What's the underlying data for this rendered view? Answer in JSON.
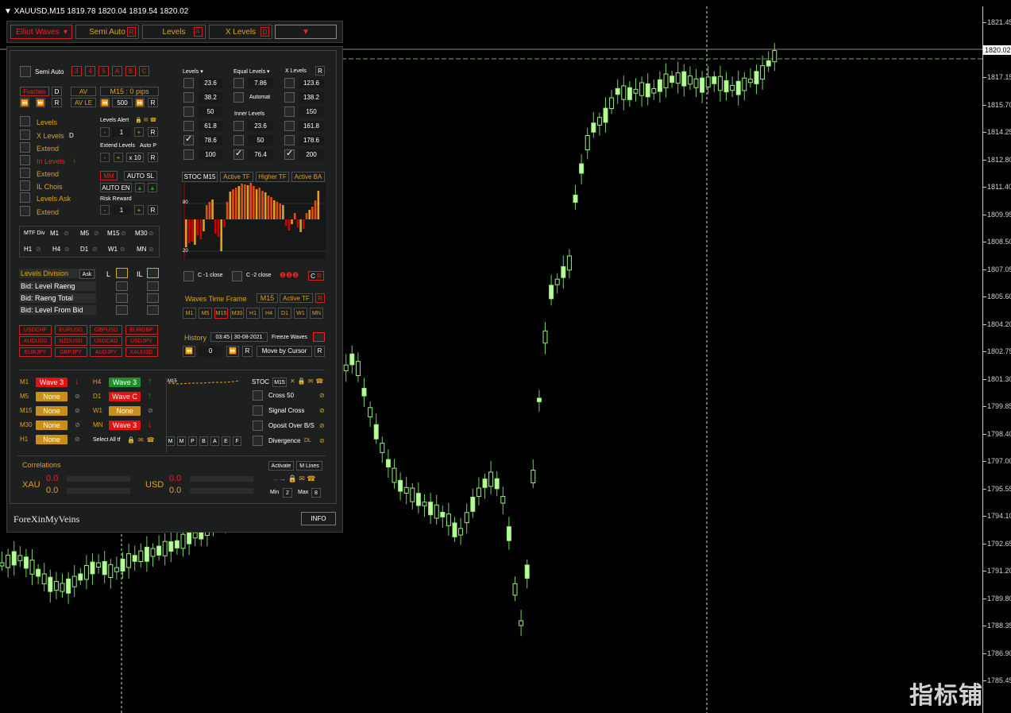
{
  "window": {
    "symbol_info": "XAUUSD,M15  1819.78 1820.04 1819.54 1820.02",
    "current_price": "1820.02",
    "watermark": "指标铺"
  },
  "price_axis": [
    "1821.45",
    "1818.60",
    "1817.15",
    "1815.70",
    "1814.25",
    "1812.80",
    "1811.40",
    "1809.95",
    "1808.50",
    "1807.05",
    "1805.60",
    "1804.20",
    "1802.75",
    "1801.30",
    "1799.85",
    "1798.40",
    "1797.00",
    "1795.55",
    "1794.10",
    "1792.65",
    "1791.20",
    "1789.80",
    "1788.35",
    "1786.90",
    "1785.45"
  ],
  "toolbar": {
    "elliot": "Elliot Waves",
    "semi_auto": "Semi Auto",
    "semi_auto_badge": "R",
    "levels": "Levels",
    "levels_badge": "IL",
    "x_levels": "X Levels",
    "x_levels_badge": "D"
  },
  "left": {
    "semi_auto": "Semi Auto",
    "wave_buttons": [
      "3",
      "4",
      "5",
      "A",
      "B",
      "C"
    ],
    "fractals": "Fractals",
    "fractals_d": "D",
    "av": "AV",
    "tf_pips": "M15 : 0  pips",
    "av_le": "AV LE",
    "nav_val": "500",
    "r": "R",
    "checks": [
      "Levels",
      "X Levels",
      "Extend",
      "In Levels",
      "Extend",
      "IL Chois",
      "Levels Ask",
      "Extend"
    ],
    "x_levels_d": "D",
    "levels_alert": "Levels Alert",
    "alert_val": "1",
    "extend_levels": "Extend Levels",
    "auto_p": "Auto P",
    "x10": "x 10",
    "mm": "MM",
    "auto_sl": "AUTO SL",
    "auto_en": "AUTO EN",
    "risk_reward": "Risk Reward",
    "rr_val": "1",
    "minus": "-",
    "plus": "+",
    "mtf_div": "MTF Div",
    "mtf_row1": [
      "M1",
      "M5",
      "M15",
      "M30"
    ],
    "mtf_row2": [
      "H1",
      "H4",
      "D1",
      "W1",
      "MN"
    ],
    "levels_division": "Levels Division",
    "ask": "Ask",
    "l": "L",
    "il": "IL",
    "bid_rows": [
      "Bid: Level Raeng",
      "Bid: Raeng Total",
      "Bid: Level From Bid"
    ],
    "pairs": [
      "USDCHF",
      "EURUSD",
      "GBPUSD",
      "EURGBP",
      "AUDUSD",
      "NZDUSD",
      "USDCAD",
      "USDJPY",
      "EURJPY",
      "GBPJPY",
      "AUDJPY",
      "XAUUSD"
    ]
  },
  "right": {
    "levels": "Levels",
    "equal_levels": "Equal Levels",
    "x_levels": "X Levels",
    "x_r": "R",
    "levels_vals": [
      "23.6",
      "38.2",
      "50",
      "61.8",
      "78.6",
      "100"
    ],
    "levels_checked": [
      false,
      false,
      false,
      false,
      true,
      false
    ],
    "equal_val": "7.86",
    "automat": "Automat",
    "inner_levels": "Inner Levels",
    "inner_vals": [
      "23.6",
      "50",
      "76.4"
    ],
    "inner_checked": [
      false,
      false,
      true
    ],
    "x_vals": [
      "123.6",
      "138.2",
      "150",
      "161.8",
      "178.6",
      "200"
    ],
    "x_checked": [
      false,
      false,
      false,
      false,
      false,
      true
    ],
    "stoc_tabs": [
      "STOC M15",
      "Active TF",
      "Higher TF",
      "Active BA"
    ],
    "stoc_hi": "80",
    "stoc_lo": "20",
    "c1_close": "C -1 close",
    "c2_close": "C -2 close",
    "c_btn": "C",
    "waves_tf": "Waves Time Frame",
    "waves_tf_val": "M15",
    "active_tf": "Active TF",
    "wave_tfs": [
      "M1",
      "M5",
      "M15",
      "M30",
      "H1",
      "H4",
      "D1",
      "W1",
      "MN"
    ],
    "history": "History",
    "history_val": "03:45 | 30-08-2021",
    "freeze": "Freeze Waves",
    "hist_step": "0",
    "move_cursor": "Move by Cursor"
  },
  "status": {
    "rows_left": [
      {
        "tf": "M1",
        "wave": "Wave 3",
        "kind": "red",
        "arrow": "↓"
      },
      {
        "tf": "M5",
        "wave": "None",
        "kind": "gold",
        "arrow": ""
      },
      {
        "tf": "M15",
        "wave": "None",
        "kind": "gold",
        "arrow": ""
      },
      {
        "tf": "M30",
        "wave": "None",
        "kind": "gold",
        "arrow": ""
      },
      {
        "tf": "H1",
        "wave": "None",
        "kind": "gold",
        "arrow": ""
      }
    ],
    "rows_right": [
      {
        "tf": "H4",
        "wave": "Wave 3",
        "kind": "grn",
        "arrow": "↑"
      },
      {
        "tf": "D1",
        "wave": "Wave C",
        "kind": "red",
        "arrow": "↑"
      },
      {
        "tf": "W1",
        "wave": "None",
        "kind": "gold",
        "arrow": ""
      },
      {
        "tf": "MN",
        "wave": "Wave 3",
        "kind": "red",
        "arrow": "↓"
      }
    ],
    "select_all": "Select All tf",
    "mini_label": "M15",
    "mpbaef": [
      "M",
      "M",
      "P",
      "B",
      "A",
      "E",
      "F"
    ],
    "stoc": "STOC",
    "stoc_tf": "M15",
    "signals": [
      "Cross 50",
      "Signal Cross",
      "Oposit Over B/S",
      "Divergence"
    ],
    "dl": "DL"
  },
  "correlations": {
    "title": "Correlations",
    "xau": "XAU",
    "usd": "USD",
    "vals": [
      "0.0",
      "0.0",
      "0.0",
      "0.0"
    ],
    "activate": "Activate",
    "m_lines": "M Lines",
    "min": "Min",
    "min_val": "2",
    "max": "Max",
    "max_val": "8"
  },
  "footer": {
    "brand": "ForeXinMyVeins",
    "info": "INFO"
  },
  "colors": {
    "accent": "#e0a020",
    "up_candle": "#b8ff9a",
    "red": "#e01212",
    "green": "#1f8f2c"
  }
}
